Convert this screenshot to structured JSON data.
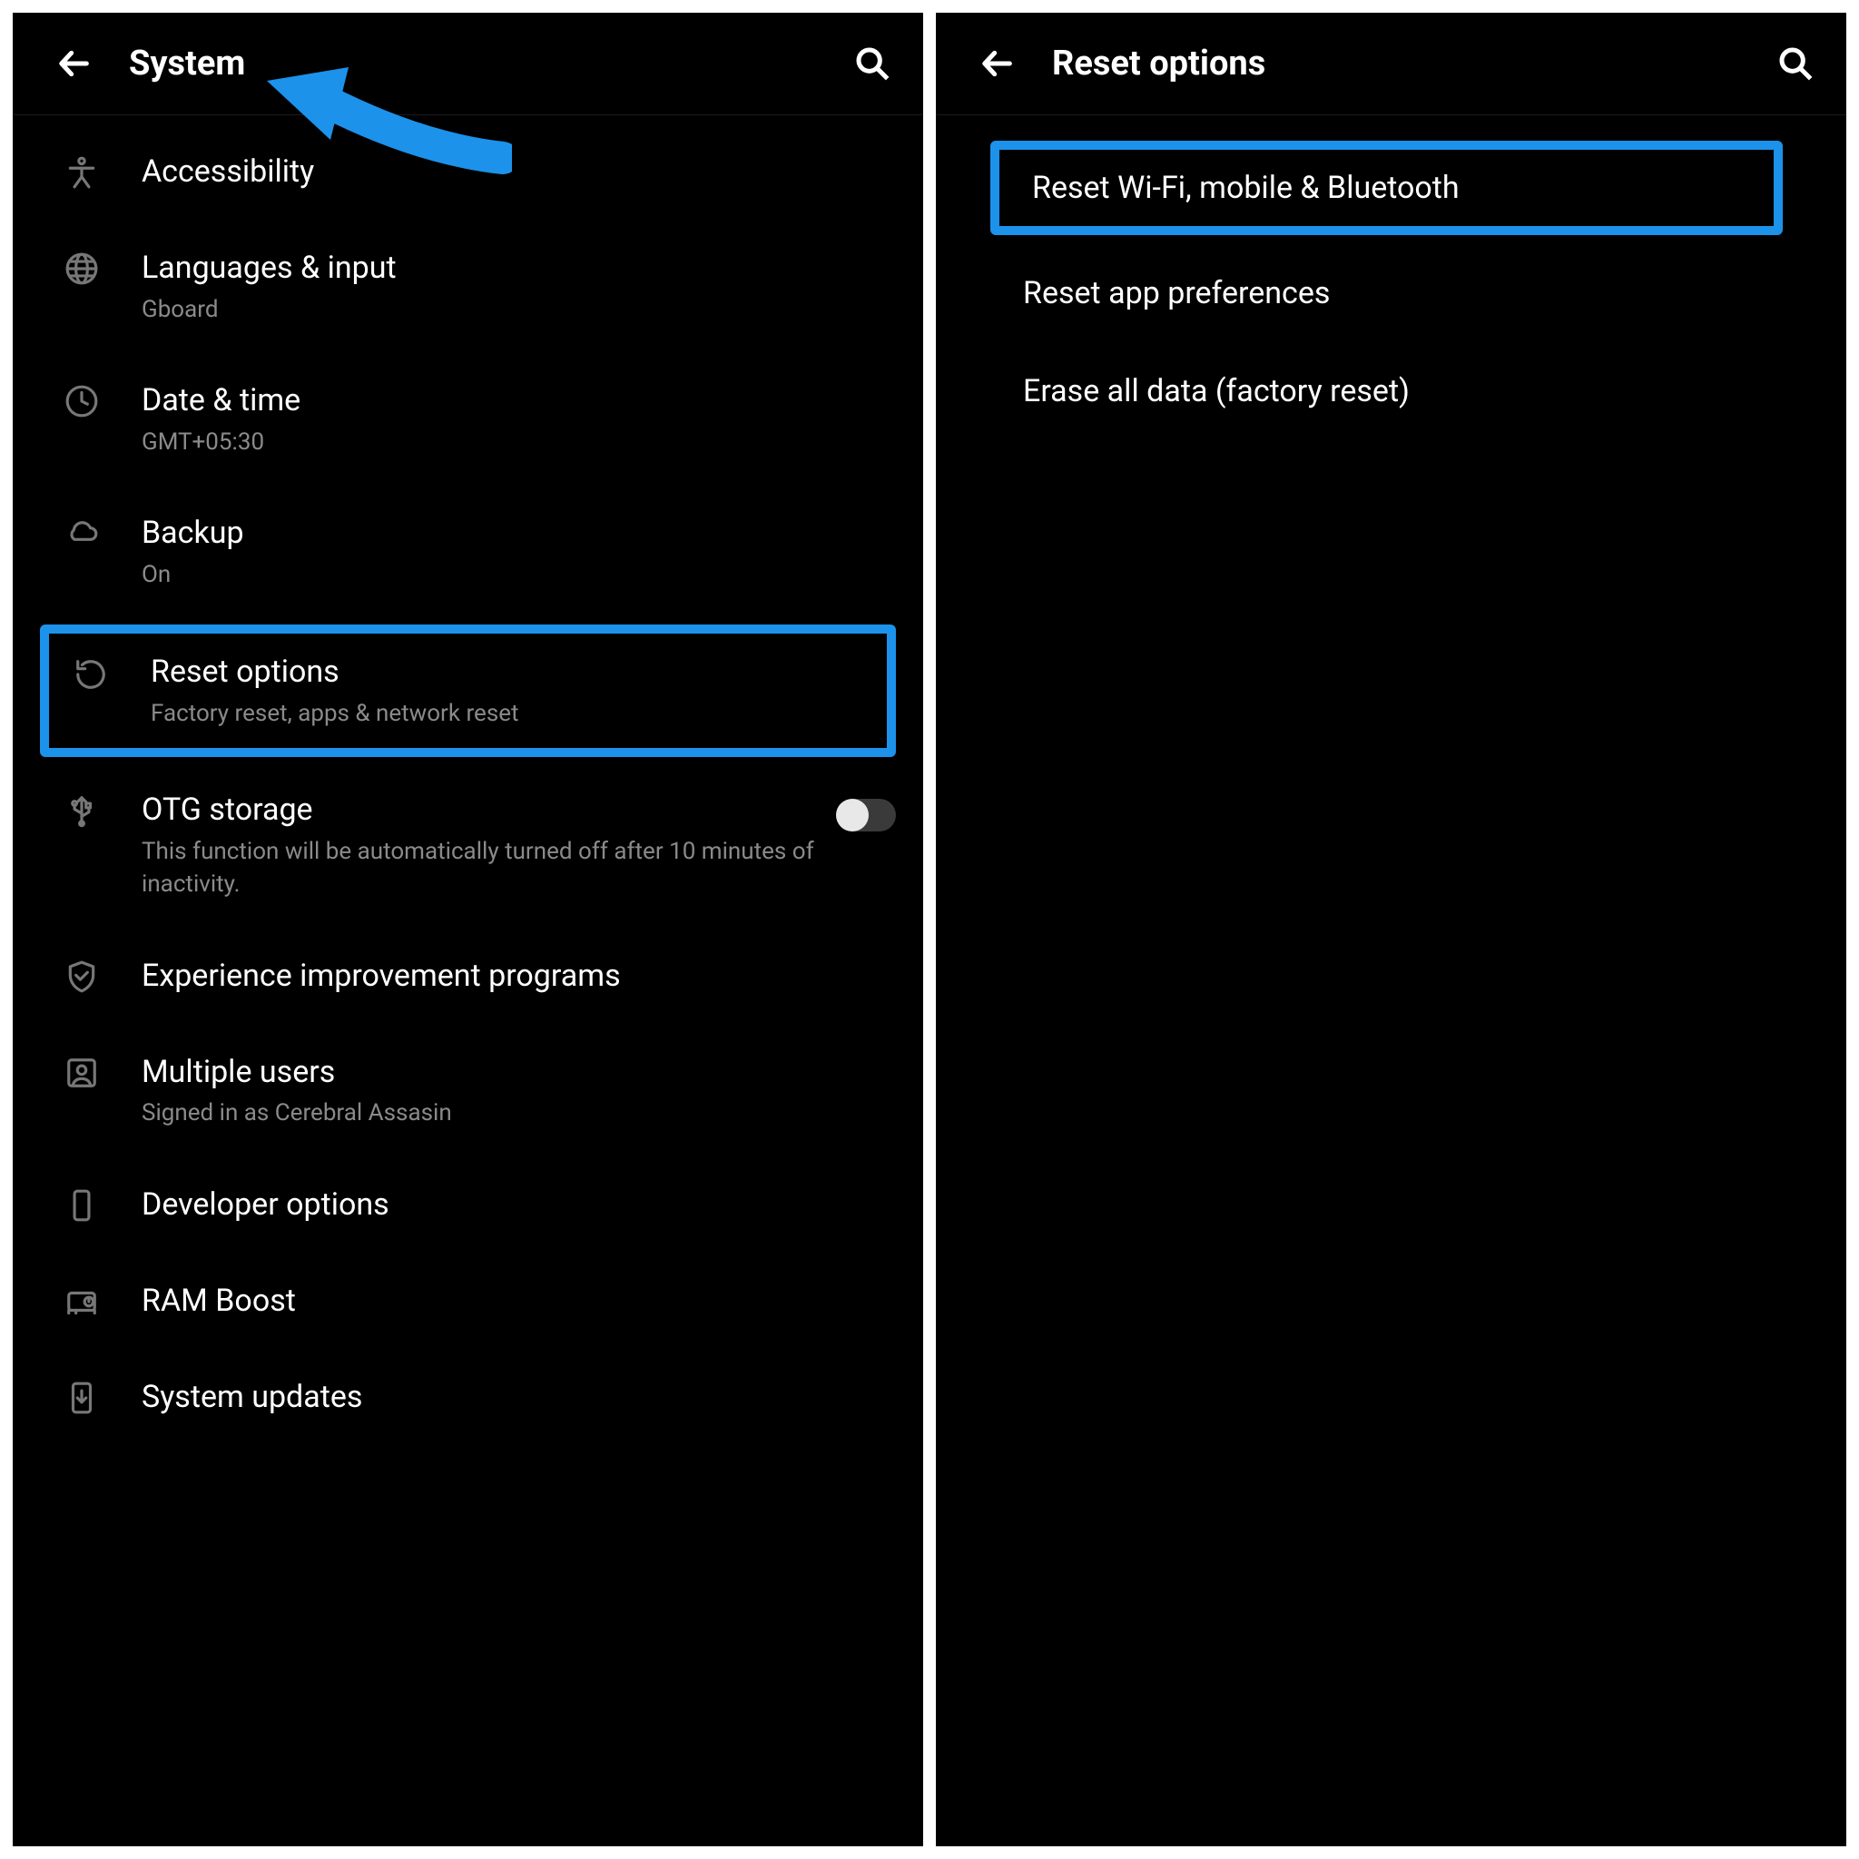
{
  "left": {
    "header": {
      "title": "System"
    },
    "items": {
      "accessibility": {
        "title": "Accessibility"
      },
      "languages": {
        "title": "Languages & input",
        "sub": "Gboard"
      },
      "datetime": {
        "title": "Date & time",
        "sub": "GMT+05:30"
      },
      "backup": {
        "title": "Backup",
        "sub": "On"
      },
      "reset": {
        "title": "Reset options",
        "sub": "Factory reset, apps & network reset"
      },
      "otg": {
        "title": "OTG storage",
        "sub": "This function will be automatically turned off after 10 minutes of inactivity."
      },
      "experience": {
        "title": "Experience improvement programs"
      },
      "users": {
        "title": "Multiple users",
        "sub": "Signed in as Cerebral Assasin"
      },
      "developer": {
        "title": "Developer options"
      },
      "ramboost": {
        "title": "RAM Boost"
      },
      "updates": {
        "title": "System updates"
      }
    }
  },
  "right": {
    "header": {
      "title": "Reset options"
    },
    "items": {
      "wifi": {
        "title": "Reset Wi-Fi, mobile & Bluetooth"
      },
      "appprefs": {
        "title": "Reset app preferences"
      },
      "erase": {
        "title": "Erase all data (factory reset)"
      }
    }
  },
  "annotation": {
    "arrow_color": "#1c92eb",
    "highlight_color": "#1c92eb"
  }
}
